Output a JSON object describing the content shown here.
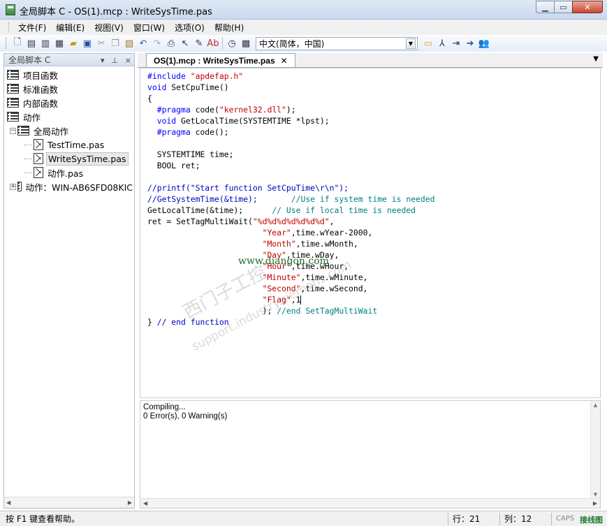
{
  "window": {
    "title": "全局脚本 C - OS(1).mcp : WriteSysTime.pas",
    "minimize_label": "▁",
    "maximize_label": "▭",
    "close_label": "✕"
  },
  "menu": [
    "文件(F)",
    "编辑(E)",
    "视图(V)",
    "窗口(W)",
    "选项(O)",
    "帮助(H)"
  ],
  "toolbar": {
    "language_value": "中文(简体，中国)",
    "icons": [
      "new-icon",
      "new-function-icon",
      "new-action-icon",
      "import-icon",
      "open-icon",
      "save-icon",
      "cut-icon",
      "copy-icon",
      "paste-icon",
      "undo-icon",
      "redo-icon",
      "print-icon",
      "help-cursor-icon",
      "compile-icon",
      "compile-all-icon",
      "trigger-icon",
      "info-icon",
      "folder-icon",
      "tag-icon",
      "export-icon",
      "goto-icon",
      "users-icon"
    ]
  },
  "left_panel": {
    "title": "全局脚本 C",
    "pin_label": "▾",
    "autohide_label": "⊥",
    "close_label": "×",
    "tree": [
      {
        "label": "项目函数",
        "type": "list"
      },
      {
        "label": "标准函数",
        "type": "list"
      },
      {
        "label": "内部函数",
        "type": "list"
      },
      {
        "label": "动作",
        "type": "list"
      },
      {
        "label": "全局动作",
        "type": "list"
      },
      {
        "label": "TestTime.pas",
        "type": "file"
      },
      {
        "label": "WriteSysTime.pas",
        "type": "file"
      },
      {
        "label": "动作.pas",
        "type": "file"
      },
      {
        "label": "动作：WIN-AB6SFD08KIC",
        "type": "list"
      }
    ]
  },
  "editor": {
    "tab_label": "OS(1).mcp : WriteSysTime.pas",
    "tab_close": "✕",
    "code_lines": [
      "#include \"apdefap.h\"",
      "void SetCpuTime()",
      "{",
      "  #pragma code(\"kernel32.dll\");",
      "  void GetLocalTime(SYSTEMTIME *lpst);",
      "  #pragma code();",
      "",
      "  SYSTEMTIME time;",
      "  BOOL ret;",
      "",
      "//printf(\"Start function SetCpuTime\\r\\n\");",
      "//GetSystemTime(&time);       //Use if system time is needed",
      "GetLocalTime(&time);      // Use if local time is needed",
      "ret = SetTagMultiWait(\"%d%d%d%d%d%d%d\",",
      "                      \"Year\",time.wYear-2000,",
      "                      \"Month\",time.wMonth,",
      "                      \"Day\",time.wDay,",
      "                      \"Hour\",time.wHour,",
      "                      \"Minute\",time.wMinute,",
      "                      \"Second\",time.wSecond,",
      "                      \"Flag\",1",
      "                      ); //end SetTagMultiWait",
      "} // end function"
    ],
    "watermark_url": "www.diangon.com",
    "watermark_cn": "西门子工控",
    "watermark_domain": "support.industry.siemens.com"
  },
  "output": {
    "lines": [
      "Compiling...",
      " 0 Error(s), 0 Warning(s)"
    ]
  },
  "status": {
    "help_text": "按 F1 键查看帮助。",
    "row": "行：21",
    "col": "列：12",
    "caps": "CAPS",
    "logo": "接线图"
  }
}
